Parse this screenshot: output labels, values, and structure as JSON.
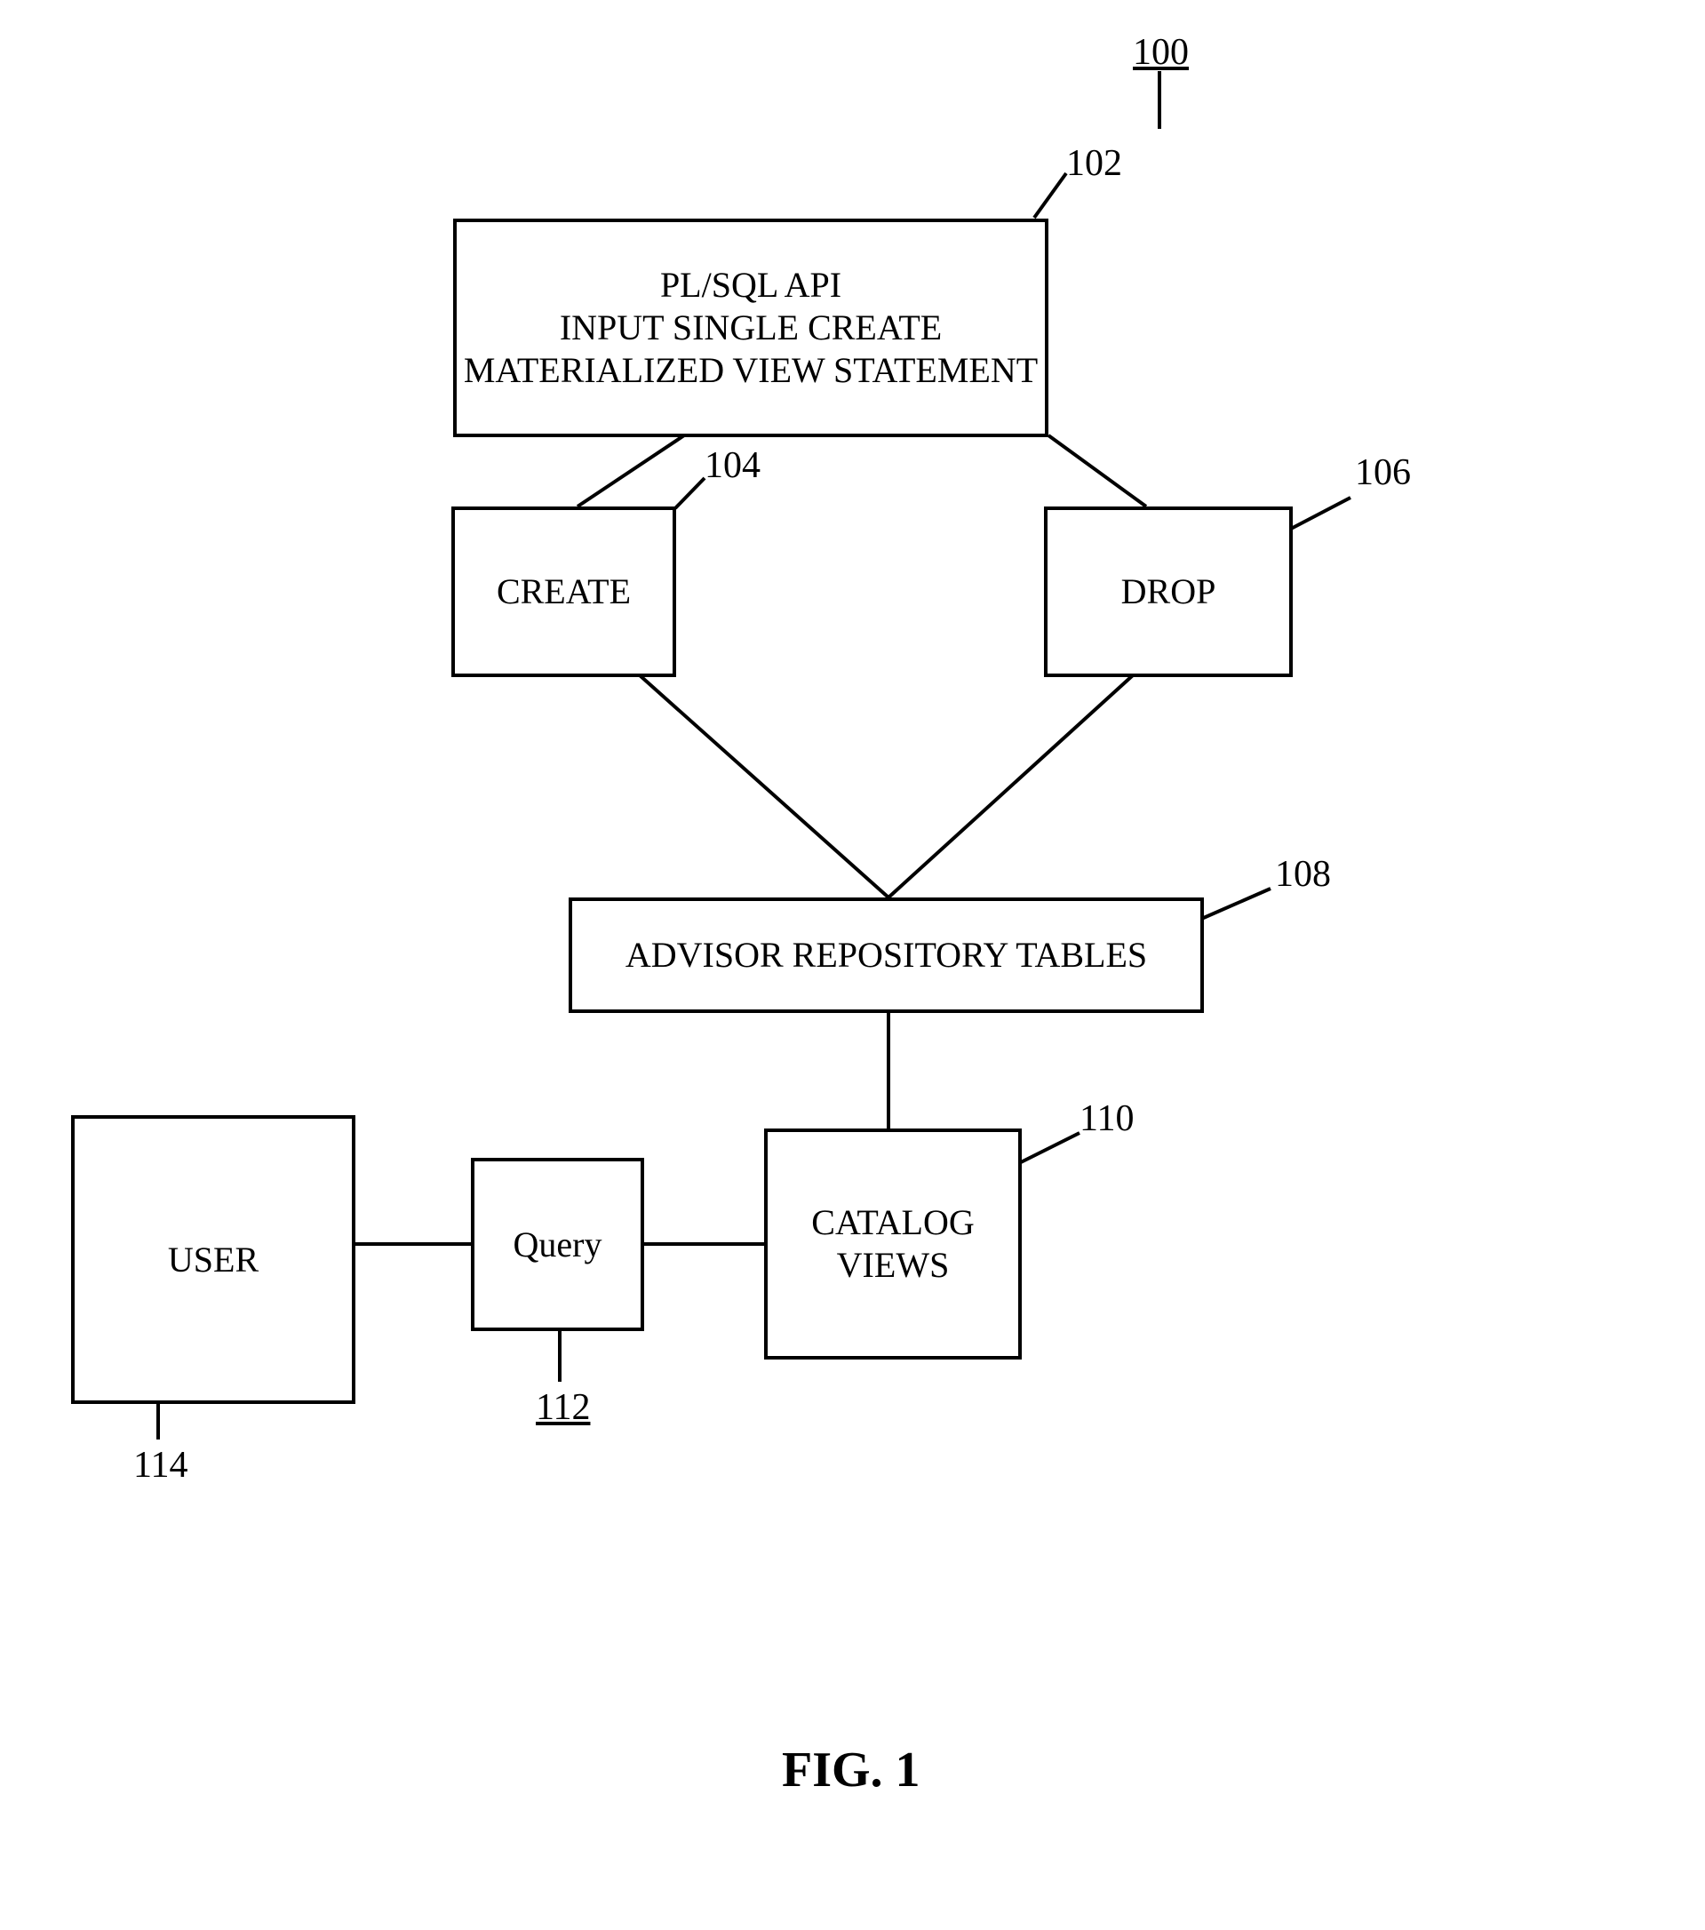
{
  "figure": {
    "number": "100",
    "caption": "FIG. 1"
  },
  "nodes": {
    "api": {
      "ref": "102",
      "line1": "PL/SQL API",
      "line2": "INPUT SINGLE CREATE",
      "line3": "MATERIALIZED VIEW STATEMENT"
    },
    "create": {
      "ref": "104",
      "label": "CREATE"
    },
    "drop": {
      "ref": "106",
      "label": "DROP"
    },
    "advisor": {
      "ref": "108",
      "label": "ADVISOR REPOSITORY TABLES"
    },
    "catalog": {
      "ref": "110",
      "label": "CATALOG\nVIEWS"
    },
    "query": {
      "ref": "112",
      "label": "Query"
    },
    "user": {
      "ref": "114",
      "label": "USER"
    }
  }
}
